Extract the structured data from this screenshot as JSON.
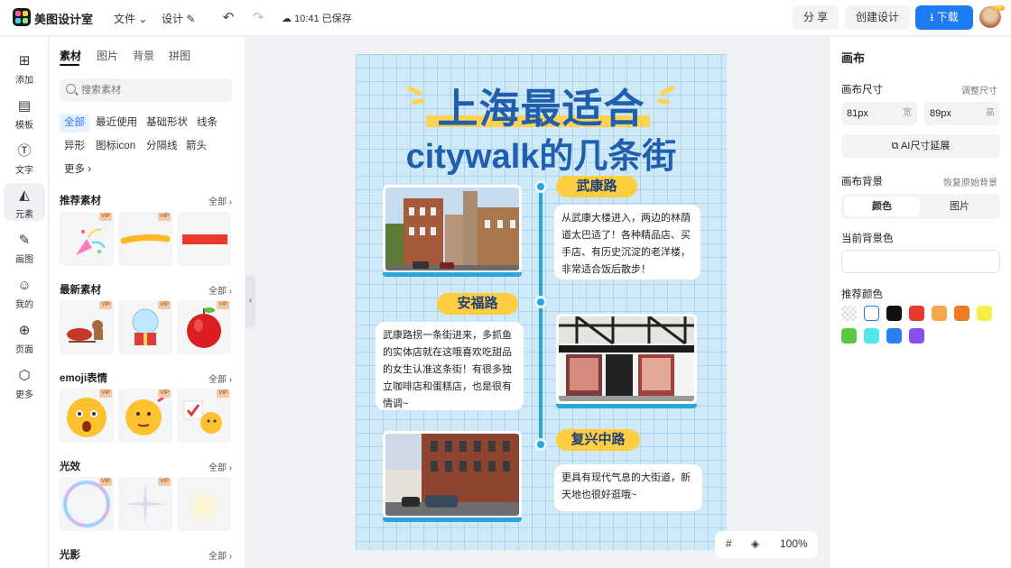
{
  "topbar": {
    "app_name": "美图设计室",
    "menu_file": "文件",
    "menu_design": "设计",
    "saved_status": "10:41 已保存",
    "share": "分 享",
    "create_design": "创建设计",
    "download": "下载",
    "vip": "VIP"
  },
  "leftnav": [
    {
      "label": "添加",
      "icon": "plus-square-icon"
    },
    {
      "label": "模板",
      "icon": "template-icon"
    },
    {
      "label": "文字",
      "icon": "text-icon"
    },
    {
      "label": "元素",
      "icon": "shapes-icon"
    },
    {
      "label": "画图",
      "icon": "pencil-icon"
    },
    {
      "label": "我的",
      "icon": "user-icon"
    },
    {
      "label": "页面",
      "icon": "page-add-icon"
    },
    {
      "label": "更多",
      "icon": "cube-icon"
    }
  ],
  "panel": {
    "tabs": [
      "素材",
      "图片",
      "背景",
      "拼图"
    ],
    "search_placeholder": "搜索素材",
    "chips": [
      "全部",
      "最近使用",
      "基础形状",
      "线条",
      "异形",
      "图标icon",
      "分隔线",
      "箭头",
      "更多"
    ],
    "sections": [
      {
        "title": "推荐素材",
        "all": "全部"
      },
      {
        "title": "最新素材",
        "all": "全部"
      },
      {
        "title": "emoji表情",
        "all": "全部"
      },
      {
        "title": "光效",
        "all": "全部"
      },
      {
        "title": "光影",
        "all": "全部"
      }
    ],
    "vip": "VIP"
  },
  "canvas": {
    "title_line1": "上海最适合",
    "title_line2": "citywalk的几条街",
    "stops": [
      {
        "name": "武康路",
        "text": "从武康大楼进入，两边的林荫道太巴适了！各种精品店、买手店、有历史沉淀的老洋楼，非常适合饭后散步！"
      },
      {
        "name": "安福路",
        "text": "武康路拐一条街进来，多抓鱼的实体店就在这哦喜欢吃甜品的女生认准这条街！有很多独立咖啡店和蛋糕店，也是很有情调~"
      },
      {
        "name": "复兴中路",
        "text": "更具有现代气息的大街道，新天地也很好逛哦~"
      }
    ]
  },
  "bottom_tools": {
    "zoom": "100%"
  },
  "right": {
    "title": "画布",
    "size_label": "画布尺寸",
    "size_adjust": "调整尺寸",
    "width_value": "81px",
    "width_unit": "宽",
    "height_value": "89px",
    "height_unit": "高",
    "ai_button": "AI尺寸延展",
    "bg_label": "画布背景",
    "bg_restore": "恢复原始背景",
    "seg_color": "颜色",
    "seg_image": "图片",
    "current_bg": "当前背景色",
    "recommend": "推荐颜色",
    "swatches": [
      "transparent",
      "#ffffff",
      "#111111",
      "#e8392c",
      "#f5a54a",
      "#ee7a22",
      "#f7ee48",
      "#58c941",
      "#4fe7e8",
      "#2b7ff0",
      "#8b4ff0"
    ]
  }
}
